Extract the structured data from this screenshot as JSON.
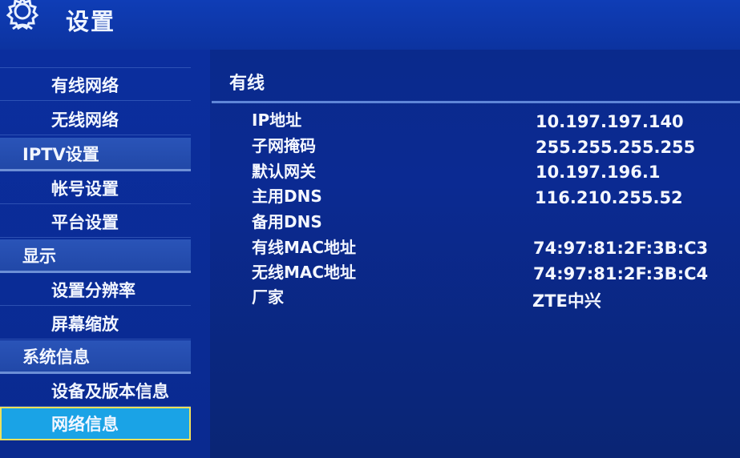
{
  "header": {
    "title": "设置",
    "icon": "gear-icon"
  },
  "sidebar": {
    "items": [
      {
        "label": "有线网络",
        "kind": "sub"
      },
      {
        "label": "无线网络",
        "kind": "sub"
      },
      {
        "label": "IPTV设置",
        "kind": "category"
      },
      {
        "label": "帐号设置",
        "kind": "sub"
      },
      {
        "label": "平台设置",
        "kind": "sub"
      },
      {
        "label": "显示",
        "kind": "category"
      },
      {
        "label": "设置分辨率",
        "kind": "sub"
      },
      {
        "label": "屏幕缩放",
        "kind": "sub"
      },
      {
        "label": "系统信息",
        "kind": "category"
      },
      {
        "label": "设备及版本信息",
        "kind": "sub"
      },
      {
        "label": "网络信息",
        "kind": "sub",
        "selected": true
      }
    ]
  },
  "panel": {
    "title": "有线",
    "rows": [
      {
        "label": "IP地址",
        "value": "10.197.197.140"
      },
      {
        "label": "子网掩码",
        "value": "255.255.255.255"
      },
      {
        "label": "默认网关",
        "value": "10.197.196.1"
      },
      {
        "label": "主用DNS",
        "value": "116.210.255.52"
      },
      {
        "label": "备用DNS",
        "value": ""
      },
      {
        "label": "有线MAC地址",
        "value": "74:97:81:2F:3B:C3"
      },
      {
        "label": "无线MAC地址",
        "value": "74:97:81:2F:3B:C4"
      },
      {
        "label": "厂家",
        "value": "ZTE中兴"
      }
    ]
  },
  "colors": {
    "background": "#0b2a92",
    "selected": "#1aa3e6",
    "selected_border": "#f0e05a",
    "category": "#2a54b8"
  }
}
